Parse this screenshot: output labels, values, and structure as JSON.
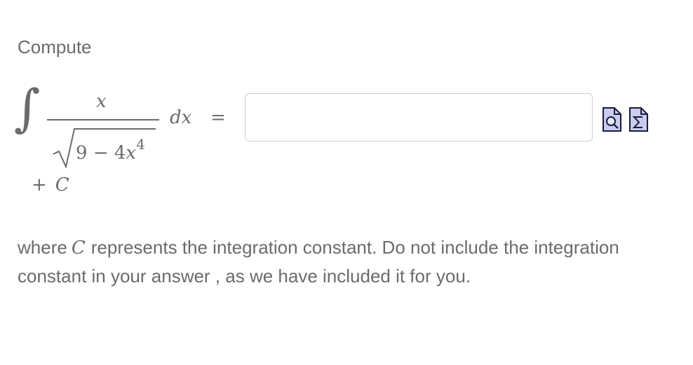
{
  "prompt": {
    "label": "Compute"
  },
  "integral": {
    "sign": "∫",
    "numerator": "x",
    "denominator_const": "9",
    "denominator_op": "−",
    "denominator_coef": "4",
    "denominator_var": "x",
    "denominator_exp": "4",
    "differential": "dx",
    "equals": "=",
    "constant_plus": "+",
    "constant": "C"
  },
  "answer": {
    "value": "",
    "placeholder": ""
  },
  "tools": {
    "preview_icon": "preview-magnifier-icon",
    "equation_icon": "equation-editor-sigma-icon",
    "icon_fill": "#c8ccf0",
    "icon_stroke": "#1a1a3a"
  },
  "description": {
    "before": "where",
    "constant": "C",
    "after": "represents the integration constant. Do not include the integration constant in your answer , as we have included it for you."
  },
  "colors": {
    "text": "#6b6b6b",
    "input_border": "#cfcfcf",
    "background": "#ffffff"
  }
}
